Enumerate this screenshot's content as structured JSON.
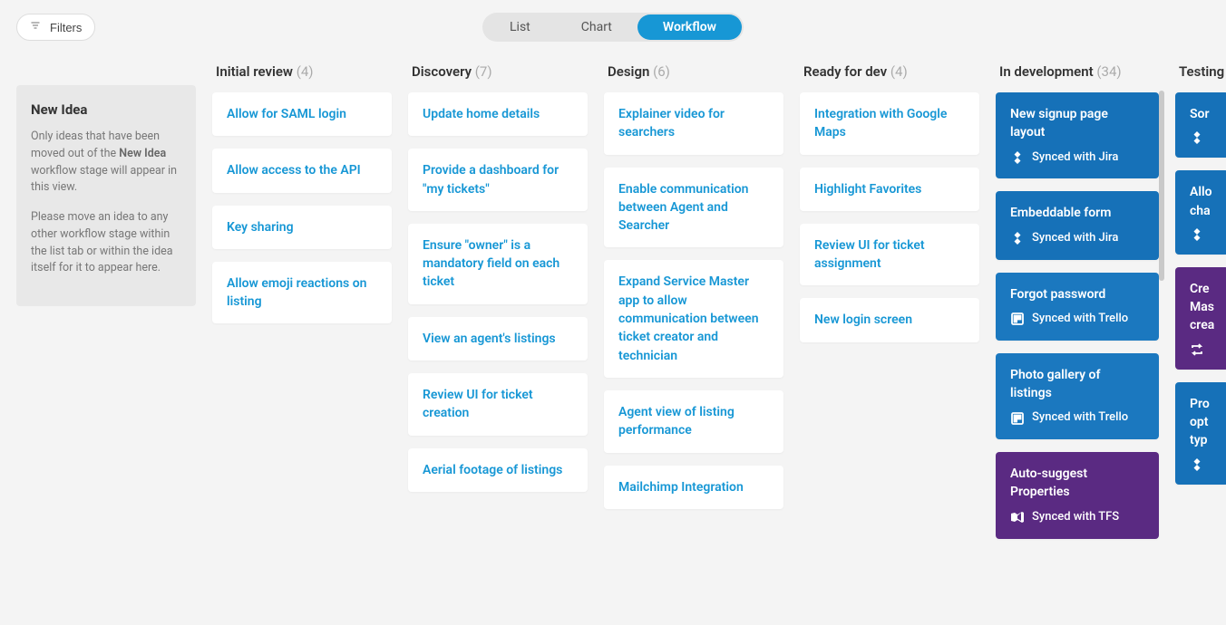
{
  "filters_label": "Filters",
  "tabs": {
    "list": "List",
    "chart": "Chart",
    "workflow": "Workflow"
  },
  "new_idea": {
    "title": "New Idea",
    "p1a": "Only ideas that have been moved out of the ",
    "p1b": "New Idea",
    "p1c": " workflow stage will appear in this view.",
    "p2": "Please move an idea to any other workflow stage within the list tab or within the idea itself for it to appear here."
  },
  "cols": {
    "initial": {
      "title": "Initial review",
      "count": "(4)",
      "cards": [
        "Allow for SAML login",
        "Allow access to the API",
        "Key sharing",
        "Allow emoji reactions on listing"
      ]
    },
    "discovery": {
      "title": "Discovery",
      "count": "(7)",
      "cards": [
        "Update home details",
        "Provide a dashboard for \"my tickets\"",
        "Ensure \"owner\" is a mandatory field on each ticket",
        "View an agent's listings",
        "Review UI for ticket creation",
        "Aerial footage of listings"
      ]
    },
    "design": {
      "title": "Design",
      "count": "(6)",
      "cards": [
        "Explainer video for searchers",
        "Enable communication between Agent and Searcher",
        "Expand Service Master app to allow communication between ticket creator and technician",
        "Agent view of listing performance",
        "Mailchimp Integration"
      ]
    },
    "ready": {
      "title": "Ready for dev",
      "count": "(4)",
      "cards": [
        "Integration with Google Maps",
        "Highlight Favorites",
        "Review UI for ticket assignment",
        "New login screen"
      ]
    },
    "indev": {
      "title": "In development",
      "count": "(34)",
      "cards": [
        {
          "t": "New signup page layout",
          "s": "Synced with Jira",
          "k": "jira",
          "c": "blue"
        },
        {
          "t": "Embeddable form",
          "s": "Synced with Jira",
          "k": "jira",
          "c": "blue"
        },
        {
          "t": "Forgot password",
          "s": "Synced with Trello",
          "k": "trello",
          "c": "blue2"
        },
        {
          "t": "Photo gallery of listings",
          "s": "Synced with Trello",
          "k": "trello",
          "c": "blue2"
        },
        {
          "t": "Auto-suggest Properties",
          "s": "Synced with TFS",
          "k": "tfs",
          "c": "purple"
        }
      ]
    },
    "testing": {
      "title": "Testing",
      "count": "",
      "cards": [
        {
          "t": "Sor",
          "s": "",
          "k": "jira",
          "c": "blue"
        },
        {
          "t": "Allo cha",
          "s": "",
          "k": "jira",
          "c": "blue"
        },
        {
          "t": "Cre Mas crea",
          "s": "",
          "k": "tfs",
          "c": "purple"
        },
        {
          "t": "Pro opt typ",
          "s": "",
          "k": "jira",
          "c": "blue"
        }
      ]
    }
  }
}
